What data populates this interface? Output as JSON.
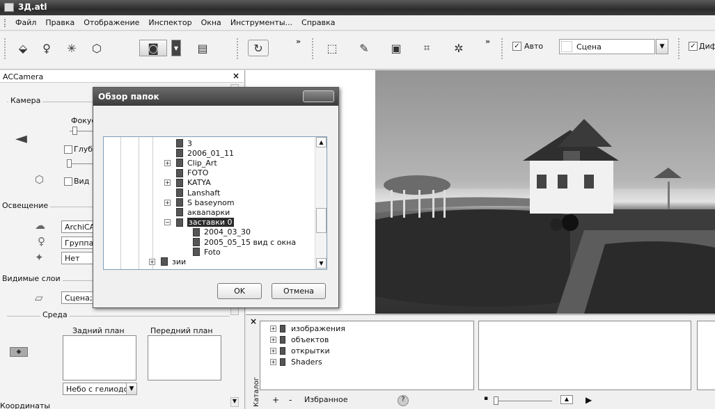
{
  "window": {
    "title": "3Д.atl"
  },
  "menu": [
    "Файл",
    "Правка",
    "Отображение",
    "Инспектор",
    "Окна",
    "Инструменты...",
    "Справка"
  ],
  "toolbar": {
    "auto_label": "Авто",
    "auto_checked": true,
    "scene_combo": "Сцена",
    "dif_label": "Диф",
    "dif_checked": true,
    "overflow": "»"
  },
  "left_panel": {
    "title": "ACCamera",
    "close": "×",
    "camera_section": "Камера",
    "focus_label": "Фокус",
    "depth_label": "Глуб",
    "view_label": "Вид",
    "lighting_section": "Освещение",
    "light_field1": "ArchiCA",
    "light_field2": "Группа",
    "light_field3": "Нет",
    "layers_section": "Видимые слои",
    "layers_field": "Сцена;",
    "env_section": "Среда",
    "background_label": "Задний план",
    "foreground_label": "Передний план",
    "sky_select": "Небо с гелиодс",
    "coords_section": "Координаты"
  },
  "dialog": {
    "title": "Обзор папок",
    "tree": [
      {
        "label": "3",
        "indent": 2,
        "expander": false,
        "selected": false
      },
      {
        "label": "2006_01_11",
        "indent": 2,
        "expander": false,
        "selected": false
      },
      {
        "label": "Clip_Art",
        "indent": 2,
        "expander": true,
        "selected": false
      },
      {
        "label": "FOTO",
        "indent": 2,
        "expander": false,
        "selected": false
      },
      {
        "label": "KATYA",
        "indent": 2,
        "expander": true,
        "selected": false
      },
      {
        "label": "Lanshaft",
        "indent": 2,
        "expander": false,
        "selected": false
      },
      {
        "label": "S baseynom",
        "indent": 2,
        "expander": true,
        "selected": false
      },
      {
        "label": "аквапарки",
        "indent": 2,
        "expander": false,
        "selected": false
      },
      {
        "label": "заставки 0",
        "indent": 2,
        "expander": true,
        "selected": true
      },
      {
        "label": "2004_03_30",
        "indent": 3,
        "expander": false,
        "selected": false
      },
      {
        "label": "2005_05_15 вид с окна",
        "indent": 3,
        "expander": false,
        "selected": false
      },
      {
        "label": "Foto",
        "indent": 3,
        "expander": false,
        "selected": false
      },
      {
        "label": "зии",
        "indent": 1,
        "expander": true,
        "selected": false
      }
    ],
    "ok": "OK",
    "cancel": "Отмена"
  },
  "catalog": {
    "side_label": "Каталог",
    "items": [
      "изображения",
      "объектов",
      "открытки",
      "Shaders"
    ],
    "add": "+",
    "remove": "-",
    "favorites": "Избранное",
    "close": "×"
  }
}
